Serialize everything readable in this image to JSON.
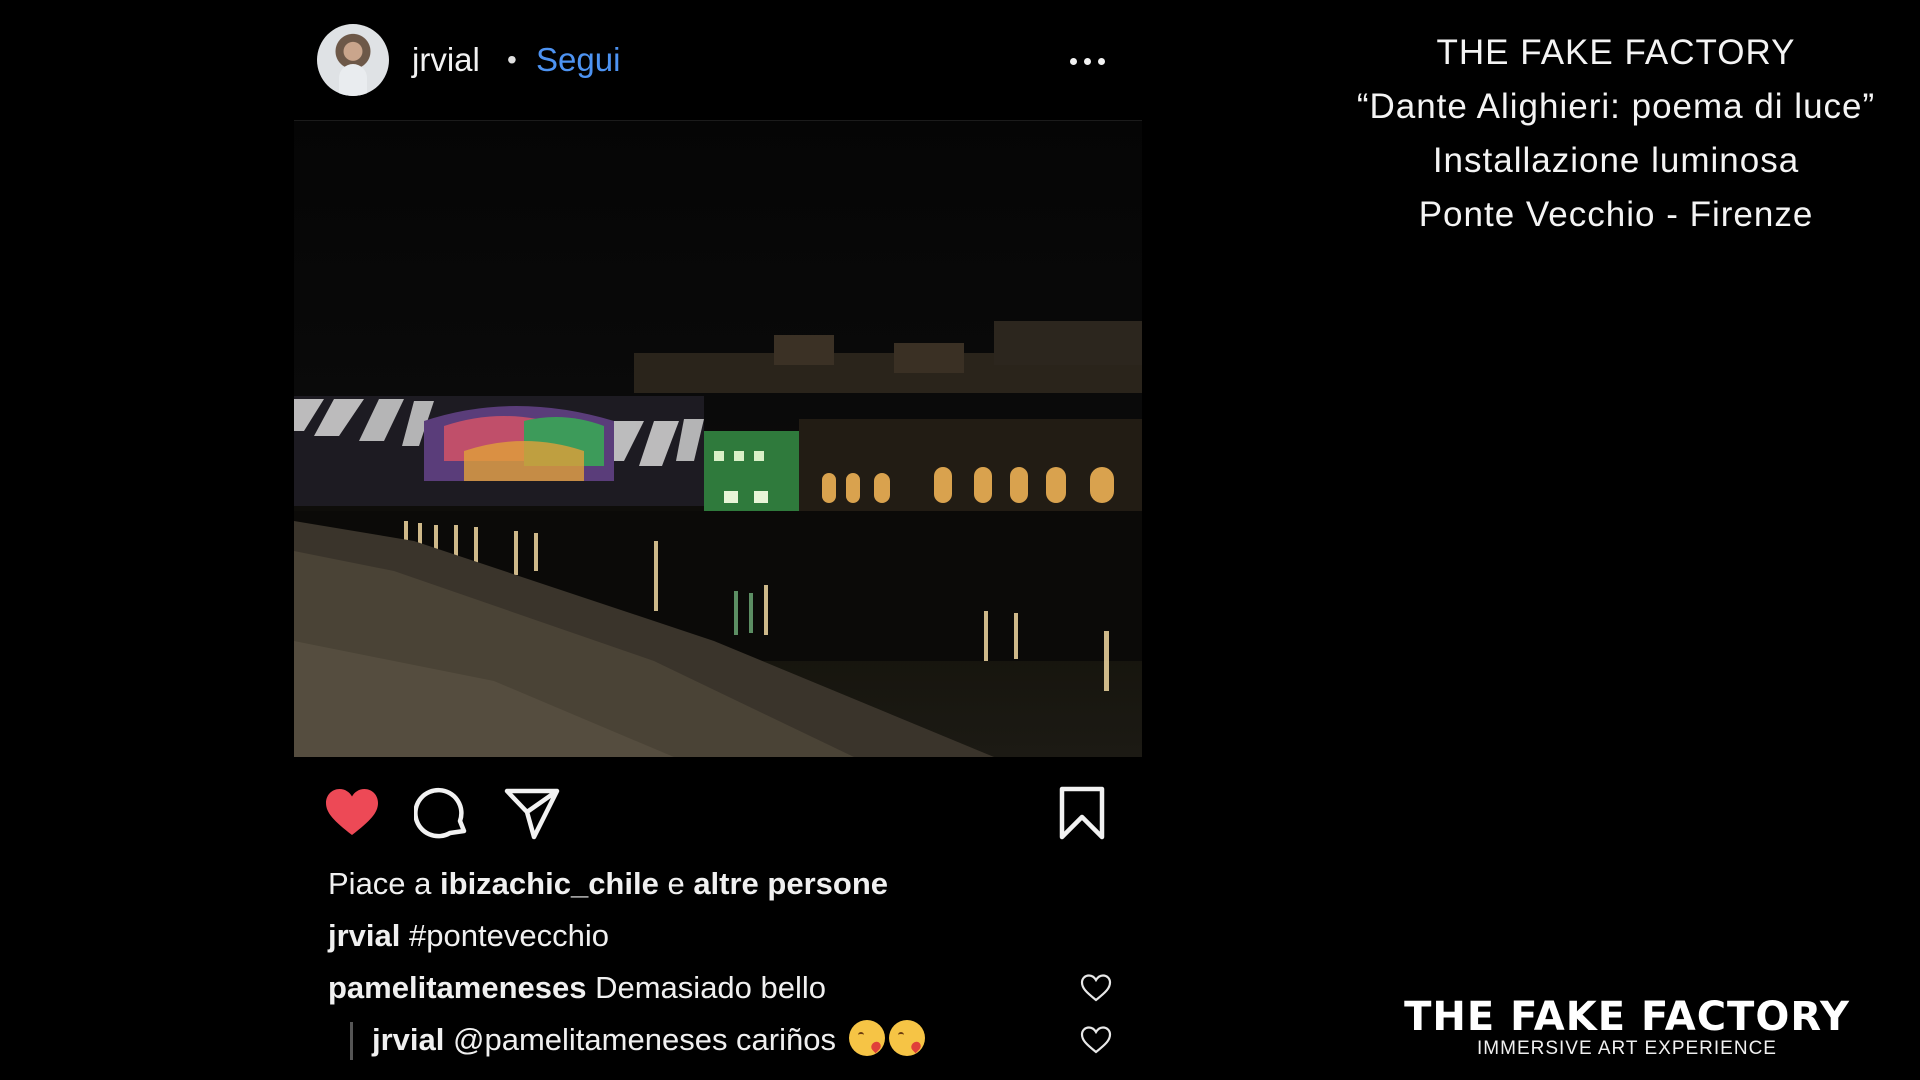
{
  "post": {
    "username": "jrvial",
    "separator": "•",
    "follow_label": "Segui",
    "more_icon": "more-horizontal-icon",
    "photo_description_icon": "photo-ponte-vecchio-night",
    "actions": {
      "like_icon": "heart-filled-icon",
      "comment_icon": "comment-icon",
      "share_icon": "send-icon",
      "save_icon": "bookmark-icon",
      "like_color": "#ed4956"
    },
    "likes": {
      "prefix": "Piace a ",
      "user": "ibizachic_chile",
      "joiner": " e ",
      "others": "altre persone"
    },
    "caption": {
      "user": "jrvial",
      "text": "#pontevecchio"
    },
    "comments": [
      {
        "user": "pamelitameneses",
        "text": "Demasiado bello"
      },
      {
        "user": "jrvial",
        "text": "@pamelitameneses cariños"
      }
    ]
  },
  "info": {
    "line1": "THE FAKE FACTORY",
    "line2": "“Dante Alighieri: poema di luce”",
    "line3": "Installazione luminosa",
    "line4": "Ponte Vecchio - Firenze"
  },
  "brand": {
    "name": "THE FAKE FACTORY",
    "tagline": "IMMERSIVE ART EXPERIENCE"
  }
}
